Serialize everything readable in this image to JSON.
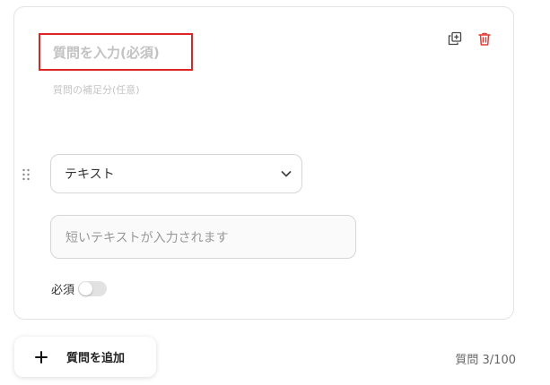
{
  "question": {
    "title_placeholder": "質問を入力(必須)",
    "supplement_placeholder": "質問の補足分(任意)"
  },
  "answer_type": {
    "selected": "テキスト"
  },
  "answer_preview": {
    "text": "短いテキストが入力されます"
  },
  "required": {
    "label": "必須",
    "enabled": false
  },
  "footer": {
    "add_button_label": "質問を追加",
    "question_count": "質問 3/100"
  },
  "icons": {
    "copy": "duplicate-icon",
    "delete": "trash-icon",
    "drag": "drag-handle-icon",
    "select": "chevron-down-icon",
    "add": "plus-icon"
  },
  "colors": {
    "highlight_border": "#e02424",
    "delete_icon": "#e53935",
    "placeholder_text": "#c2c2c2"
  }
}
